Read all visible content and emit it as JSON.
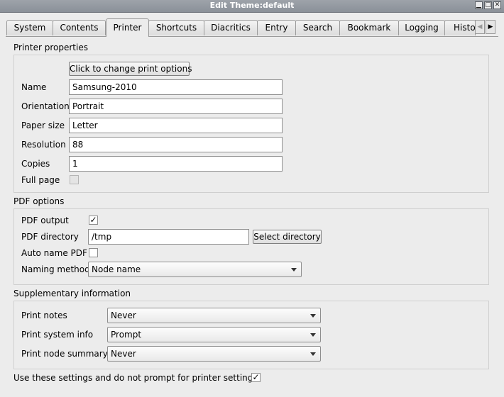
{
  "window": {
    "title": "Edit Theme:default"
  },
  "tabs": [
    "System",
    "Contents",
    "Printer",
    "Shortcuts",
    "Diacritics",
    "Entry",
    "Search",
    "Bookmark",
    "Logging",
    "Histo"
  ],
  "printer_properties": {
    "section_title": "Printer properties",
    "change_options_button": "Click to change print options",
    "name_label": "Name",
    "name_value": "Samsung-2010",
    "orientation_label": "Orientation",
    "orientation_value": "Portrait",
    "paper_size_label": "Paper size",
    "paper_size_value": "Letter",
    "resolution_label": "Resolution",
    "resolution_value": "88",
    "copies_label": "Copies",
    "copies_value": "1",
    "full_page_label": "Full page",
    "full_page_checked": false
  },
  "pdf_options": {
    "section_title": "PDF options",
    "pdf_output_label": "PDF output",
    "pdf_output_checked": true,
    "pdf_directory_label": "PDF directory",
    "pdf_directory_value": "/tmp",
    "select_directory_button": "Select directory",
    "auto_name_label": "Auto name PDF",
    "auto_name_checked": false,
    "naming_method_label": "Naming method",
    "naming_method_value": "Node name"
  },
  "supplementary": {
    "section_title": "Supplementary information",
    "print_notes_label": "Print notes",
    "print_notes_value": "Never",
    "print_system_info_label": "Print system info",
    "print_system_info_value": "Prompt",
    "print_node_summary_label": "Print node summary",
    "print_node_summary_value": "Never"
  },
  "use_settings": {
    "label": "Use these settings and do not prompt for printer settings",
    "checked": true
  },
  "glyphs": {
    "check": "✓",
    "scroll_left": "◀",
    "scroll_right": "▶",
    "minimize": "▁",
    "maximize": "□",
    "close": "✕"
  }
}
